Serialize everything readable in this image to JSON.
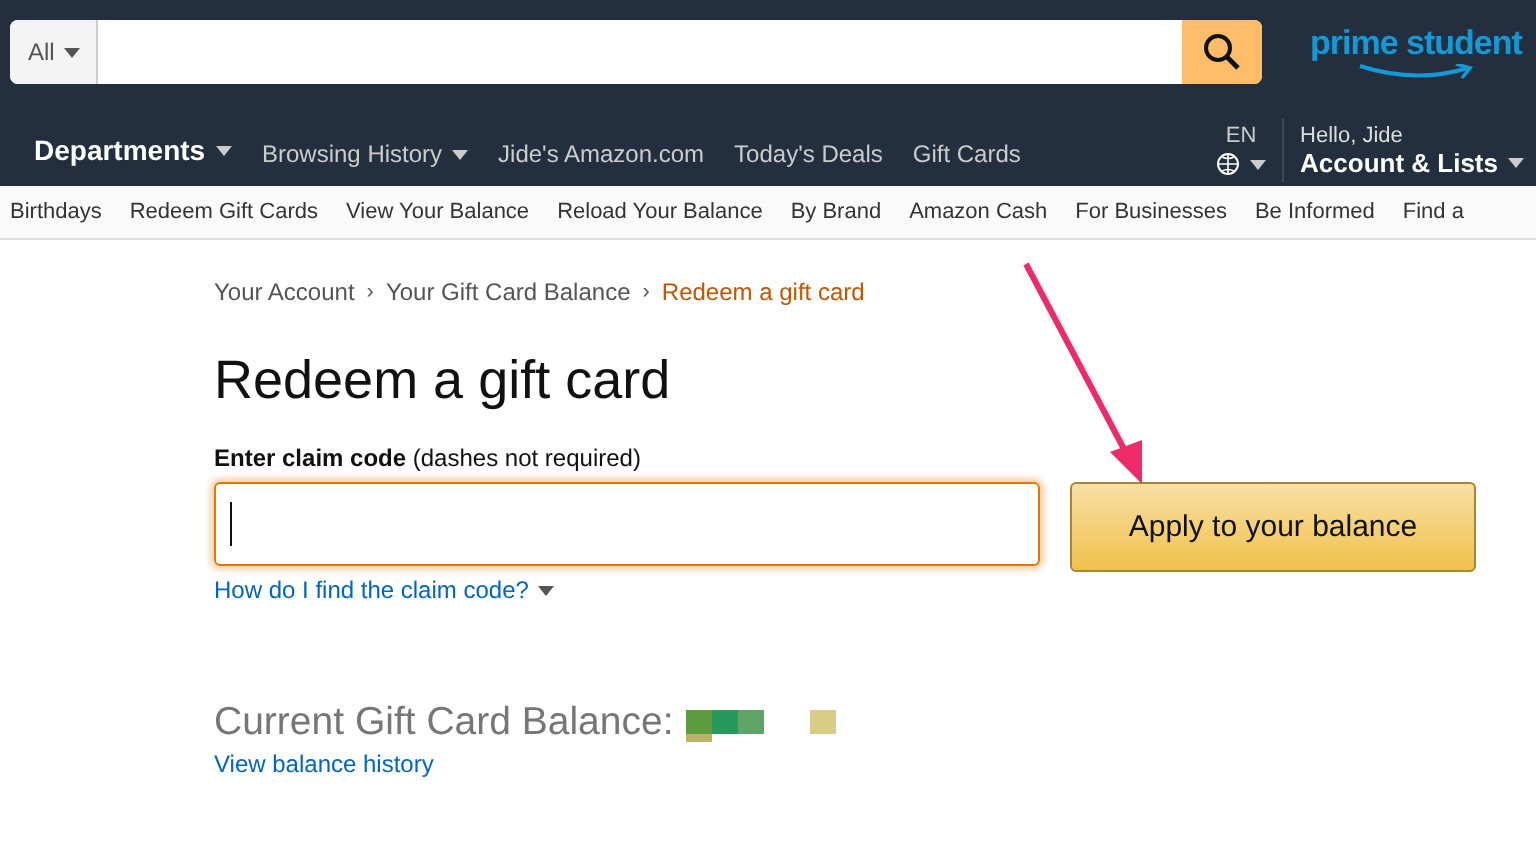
{
  "search": {
    "category": "All"
  },
  "logo": {
    "text": "prime student"
  },
  "nav": {
    "departments": "Departments",
    "links": [
      {
        "label": "Browsing History",
        "dropdown": true
      },
      {
        "label": "Jide's Amazon.com",
        "dropdown": false
      },
      {
        "label": "Today's Deals",
        "dropdown": false
      },
      {
        "label": "Gift Cards",
        "dropdown": false
      }
    ],
    "language": "EN",
    "greeting": "Hello, Jide",
    "account": "Account & Lists"
  },
  "subnav": [
    "Birthdays",
    "Redeem Gift Cards",
    "View Your Balance",
    "Reload Your Balance",
    "By Brand",
    "Amazon Cash",
    "For Businesses",
    "Be Informed",
    "Find a"
  ],
  "breadcrumb_separator": "›",
  "breadcrumb": [
    {
      "label": "Your Account",
      "current": false
    },
    {
      "label": "Your Gift Card Balance",
      "current": false
    },
    {
      "label": "Redeem a gift card",
      "current": true
    }
  ],
  "title": "Redeem a gift card",
  "claim": {
    "label": "Enter claim code",
    "hint": "(dashes not required)",
    "focused": true
  },
  "help_link": "How do I find the claim code?",
  "apply_button": "Apply to your balance",
  "balance": {
    "label": "Current Gift Card Balance:",
    "history_link": "View balance history"
  }
}
